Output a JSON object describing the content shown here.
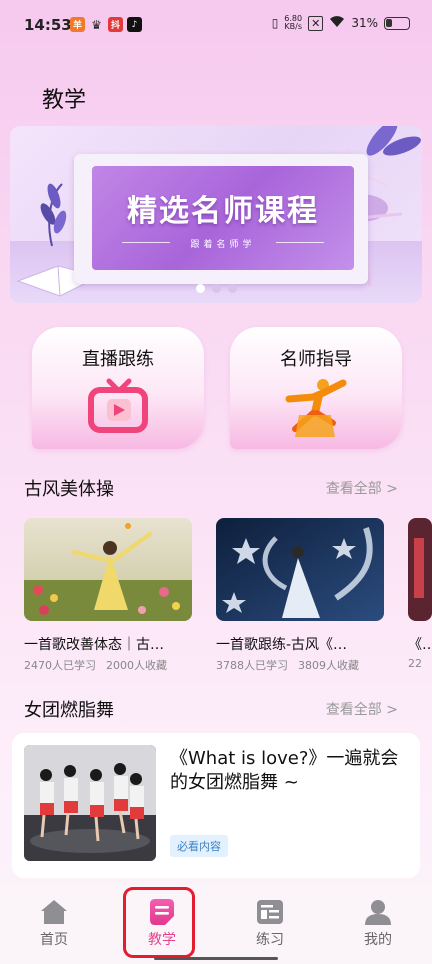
{
  "status_bar": {
    "time": "14:53",
    "net_speed_value": "6.80",
    "net_speed_unit": "KB/s",
    "battery": "31%"
  },
  "page_title": "教学",
  "banner": {
    "title": "精选名师课程",
    "subtitle": "跟着名师学",
    "dots_total": 3,
    "active_dot": 0
  },
  "features": [
    {
      "label": "直播跟练",
      "icon": "live-tv-icon"
    },
    {
      "label": "名师指导",
      "icon": "dancer-icon"
    }
  ],
  "section_ancient": {
    "title": "古风美体操",
    "view_all": "查看全部 >",
    "courses": [
      {
        "name": "一首歌改善体态｜古…",
        "learners": "2470人已学习",
        "favorites": "2000人收藏"
      },
      {
        "name": "一首歌跟练-古风《…",
        "learners": "3788人已学习",
        "favorites": "3809人收藏"
      },
      {
        "name": "《…",
        "learners": "22"
      }
    ]
  },
  "section_girlgroup": {
    "title": "女团燃脂舞",
    "view_all": "查看全部 >",
    "card": {
      "title": "《What is love?》一遍就会的女团燃脂舞 ~",
      "tag": "必看内容"
    }
  },
  "bottom_nav": [
    {
      "label": "首页",
      "icon": "home-icon"
    },
    {
      "label": "教学",
      "icon": "teach-icon",
      "active": true
    },
    {
      "label": "练习",
      "icon": "practice-icon"
    },
    {
      "label": "我的",
      "icon": "profile-icon"
    }
  ],
  "colors": {
    "accent": "#e4458e",
    "highlight": "#e11d2e",
    "tag_bg": "#e3f1ff",
    "tag_text": "#3b82c4"
  }
}
